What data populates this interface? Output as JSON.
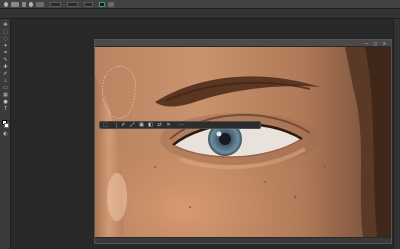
{
  "options_bar": {
    "label_1": "",
    "label_2": "",
    "label_3": "",
    "label_4": ""
  },
  "document": {
    "title": "",
    "window_controls": "— ▢ ✕"
  },
  "status_bar": {
    "zoom": "",
    "info": ""
  },
  "taskbar": {
    "label_1": "",
    "label_2": ""
  },
  "toolbar_icons": [
    "move-icon",
    "marquee-icon",
    "lasso-icon",
    "quick-select-icon",
    "crop-icon",
    "eyedropper-icon",
    "healing-brush-icon",
    "brush-icon",
    "clone-stamp-icon",
    "history-brush-icon",
    "eraser-icon",
    "gradient-icon",
    "blur-icon",
    "dodge-icon",
    "pen-icon",
    "type-icon",
    "path-select-icon",
    "shape-icon",
    "hand-icon",
    "zoom-icon"
  ],
  "colors": {
    "app_background": "#282828",
    "panel": "#3a3a3a",
    "accent_swatch": "#3aa06b",
    "foreground_color": "#ffffff",
    "background_color": "#ffffff"
  }
}
